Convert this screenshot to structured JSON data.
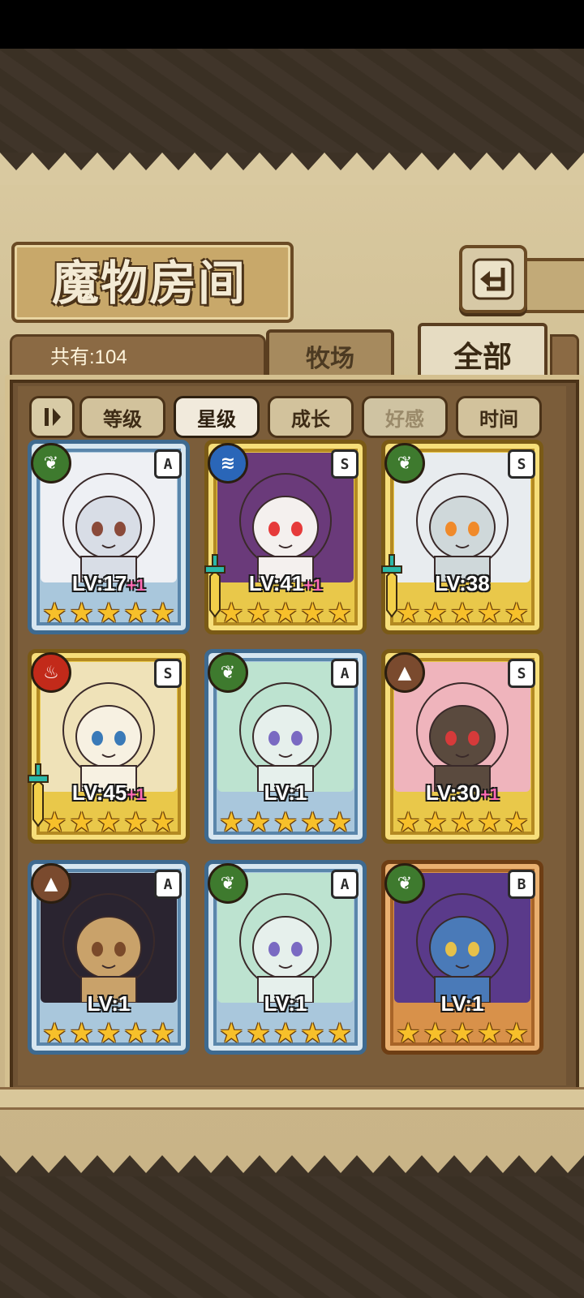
{
  "header": {
    "title": "魔物房间",
    "back_icon": "back-arrow-icon"
  },
  "tabs": {
    "count_label": "共有:104",
    "ranch": "牧场",
    "all": "全部",
    "active": "all"
  },
  "sort": {
    "toggle_icon": "sort-order-icon",
    "buttons": [
      {
        "label": "等级",
        "state": "normal"
      },
      {
        "label": "星级",
        "state": "active"
      },
      {
        "label": "成长",
        "state": "normal"
      },
      {
        "label": "好感",
        "state": "disabled"
      },
      {
        "label": "时间",
        "state": "normal"
      }
    ]
  },
  "cards": [
    {
      "frame": "blue",
      "element": "leaf",
      "rank": "A",
      "level": "LV:17",
      "bonus": "+1",
      "stars": 5,
      "weapon": false,
      "portrait": "white-hair-girl-with-harp"
    },
    {
      "frame": "gold",
      "element": "water",
      "rank": "S",
      "level": "LV:41",
      "bonus": "+1",
      "stars": 5,
      "weapon": true,
      "portrait": "clown"
    },
    {
      "frame": "gold",
      "element": "leaf",
      "rank": "S",
      "level": "LV:38",
      "bonus": "",
      "stars": 5,
      "weapon": true,
      "portrait": "jiangshi-girl"
    },
    {
      "frame": "gold",
      "element": "fire",
      "rank": "S",
      "level": "LV:45",
      "bonus": "+1",
      "stars": 5,
      "weapon": true,
      "portrait": "blonde-girl-with-hat"
    },
    {
      "frame": "blue",
      "element": "leaf",
      "rank": "A",
      "level": "LV:1",
      "bonus": "",
      "stars": 5,
      "weapon": false,
      "portrait": "mint-hair-girl"
    },
    {
      "frame": "gold",
      "element": "earth",
      "rank": "S",
      "level": "LV:30",
      "bonus": "+1",
      "stars": 5,
      "weapon": false,
      "portrait": "pink-hair-girl"
    },
    {
      "frame": "blue",
      "element": "earth",
      "rank": "A",
      "level": "LV:1",
      "bonus": "",
      "stars": 5,
      "weapon": false,
      "portrait": "egyptian-girl"
    },
    {
      "frame": "blue",
      "element": "leaf",
      "rank": "A",
      "level": "LV:1",
      "bonus": "",
      "stars": 5,
      "weapon": false,
      "portrait": "mint-hair-girl"
    },
    {
      "frame": "bronze",
      "element": "leaf",
      "rank": "B",
      "level": "LV:1",
      "bonus": "",
      "stars": 5,
      "weapon": false,
      "portrait": "blue-skin-genie"
    }
  ],
  "colors": {
    "parchment": "#d9c9a0",
    "panel": "#7b5d3a",
    "star": "#f7c02a",
    "bonus": "#ff6ab4"
  }
}
